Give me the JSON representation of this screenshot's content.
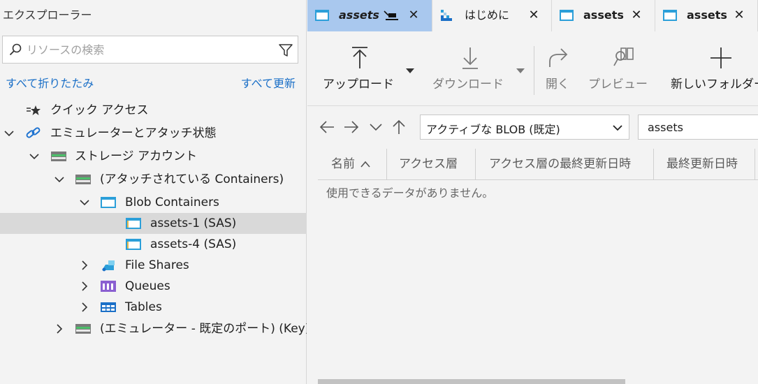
{
  "explorer": {
    "title": "エクスプローラー",
    "search_placeholder": "リソースの検索",
    "collapse_all": "すべて折りたたみ",
    "refresh_all": "すべて更新",
    "tree": [
      {
        "label": "クイック アクセス",
        "icon": "quick-access-icon",
        "expanded": null
      },
      {
        "label": "エミュレーターとアタッチ状態",
        "icon": "link-icon",
        "expanded": true
      },
      {
        "label": "ストレージ アカウント",
        "icon": "storage-account-icon",
        "expanded": true
      },
      {
        "label": "(アタッチされている Containers)",
        "icon": "storage-account-icon",
        "expanded": true
      },
      {
        "label": "Blob Containers",
        "icon": "blob-container-icon",
        "expanded": true
      },
      {
        "label": "assets-1 (SAS)",
        "icon": "blob-container-icon",
        "expanded": null,
        "selected": true
      },
      {
        "label": "assets-4 (SAS)",
        "icon": "blob-container-icon",
        "expanded": null
      },
      {
        "label": "File Shares",
        "icon": "file-share-icon",
        "expanded": false
      },
      {
        "label": "Queues",
        "icon": "queue-icon",
        "expanded": false
      },
      {
        "label": "Tables",
        "icon": "table-icon",
        "expanded": false
      },
      {
        "label": "(エミュレーター - 既定のポート) (Key)",
        "icon": "storage-account-icon",
        "expanded": false
      }
    ]
  },
  "tabs": [
    {
      "label": "assets",
      "icon": "blob-container-icon",
      "active": true
    },
    {
      "label": "はじめに",
      "icon": "getting-started-icon",
      "active": false
    },
    {
      "label": "assets",
      "icon": "blob-container-icon",
      "active": false
    },
    {
      "label": "assets",
      "icon": "blob-container-icon",
      "active": false
    }
  ],
  "toolbar": {
    "upload": "アップロード",
    "download": "ダウンロード",
    "open": "開く",
    "preview": "プレビュー",
    "new_folder": "新しいフォルダー"
  },
  "nav": {
    "view_select": "アクティブな BLOB (既定)",
    "path": "assets"
  },
  "grid": {
    "columns": [
      "名前",
      "アクセス層",
      "アクセス層の最終更新日時",
      "最終更新日時"
    ],
    "empty_message": "使用できるデータがありません。"
  },
  "colors": {
    "accent": "#1a6fc7",
    "active_tab": "#a9c8ee",
    "container_blue": "#2b9fd9"
  }
}
